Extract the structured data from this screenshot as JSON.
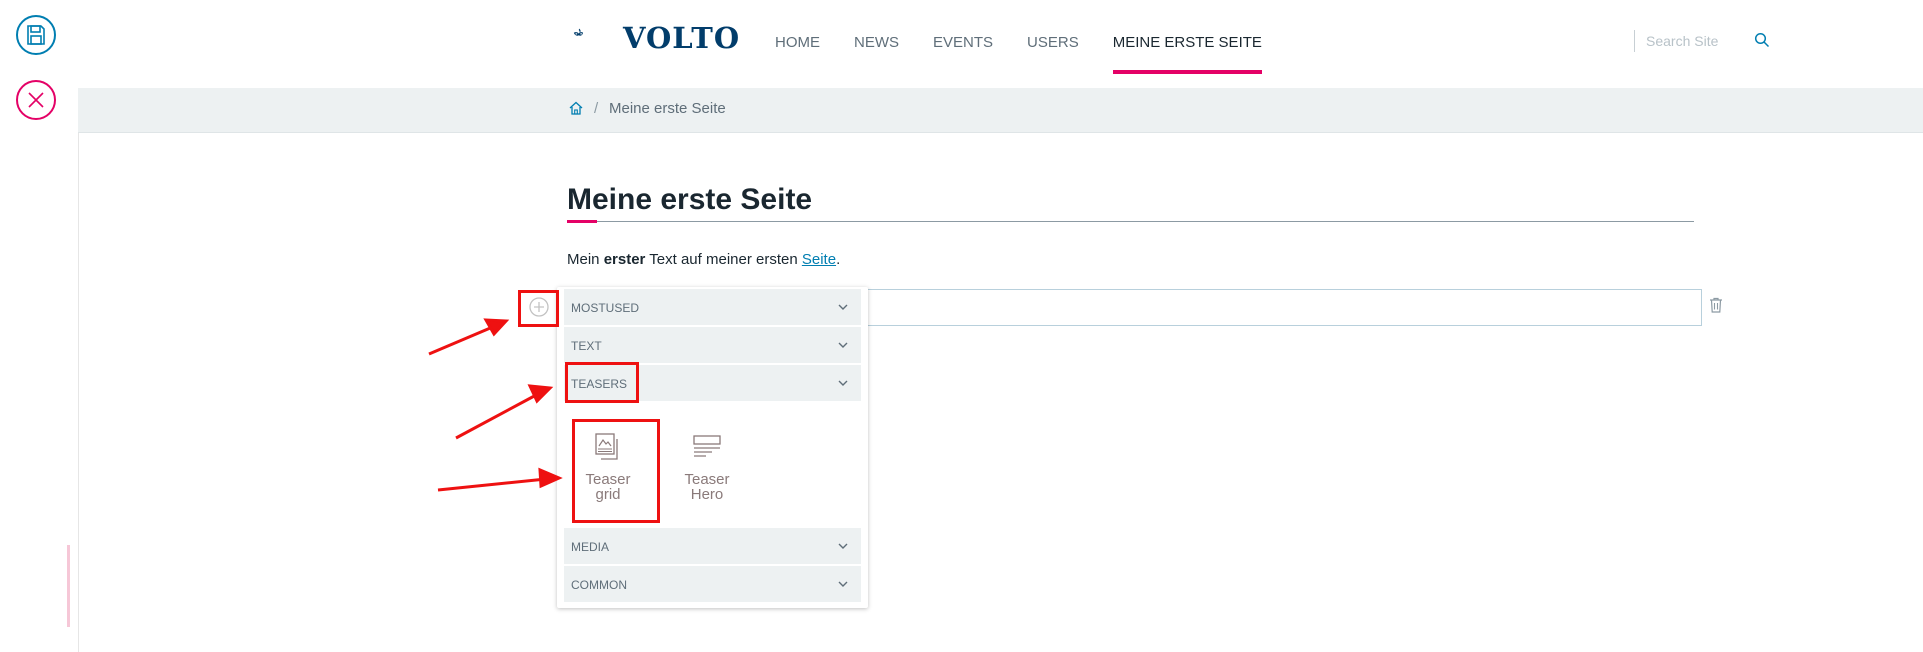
{
  "toolbar": {
    "save_icon": "save-icon",
    "close_icon": "close-icon"
  },
  "header": {
    "logo_text": "VOLTO",
    "nav": [
      {
        "label": "HOME",
        "active": false
      },
      {
        "label": "NEWS",
        "active": false
      },
      {
        "label": "EVENTS",
        "active": false
      },
      {
        "label": "USERS",
        "active": false
      },
      {
        "label": "MEINE ERSTE SEITE",
        "active": true
      }
    ],
    "search": {
      "placeholder": "Search Site",
      "value": ""
    }
  },
  "breadcrumb": {
    "home_icon": "home-icon",
    "separator": "/",
    "current": "Meine erste Seite"
  },
  "page": {
    "title": "Meine erste Seite",
    "intro": {
      "pre": "Mein ",
      "bold": "erster",
      "mid": " Text auf meiner ersten ",
      "link": "Seite",
      "post": "."
    }
  },
  "chooser": {
    "groups": [
      {
        "label": "MOSTUSED"
      },
      {
        "label": "TEXT"
      },
      {
        "label": "TEASERS",
        "expanded": true
      },
      {
        "label": "MEDIA"
      },
      {
        "label": "COMMON"
      }
    ],
    "teasers_blocks": [
      {
        "label_line1": "Teaser",
        "label_line2": "grid",
        "icon": "teaser-grid-icon"
      },
      {
        "label_line1": "Teaser",
        "label_line2": "Hero",
        "icon": "teaser-hero-icon"
      }
    ]
  },
  "colors": {
    "accent_pink": "#e40166",
    "primary_blue": "#007eb1",
    "annotation_red": "#ee1111"
  }
}
